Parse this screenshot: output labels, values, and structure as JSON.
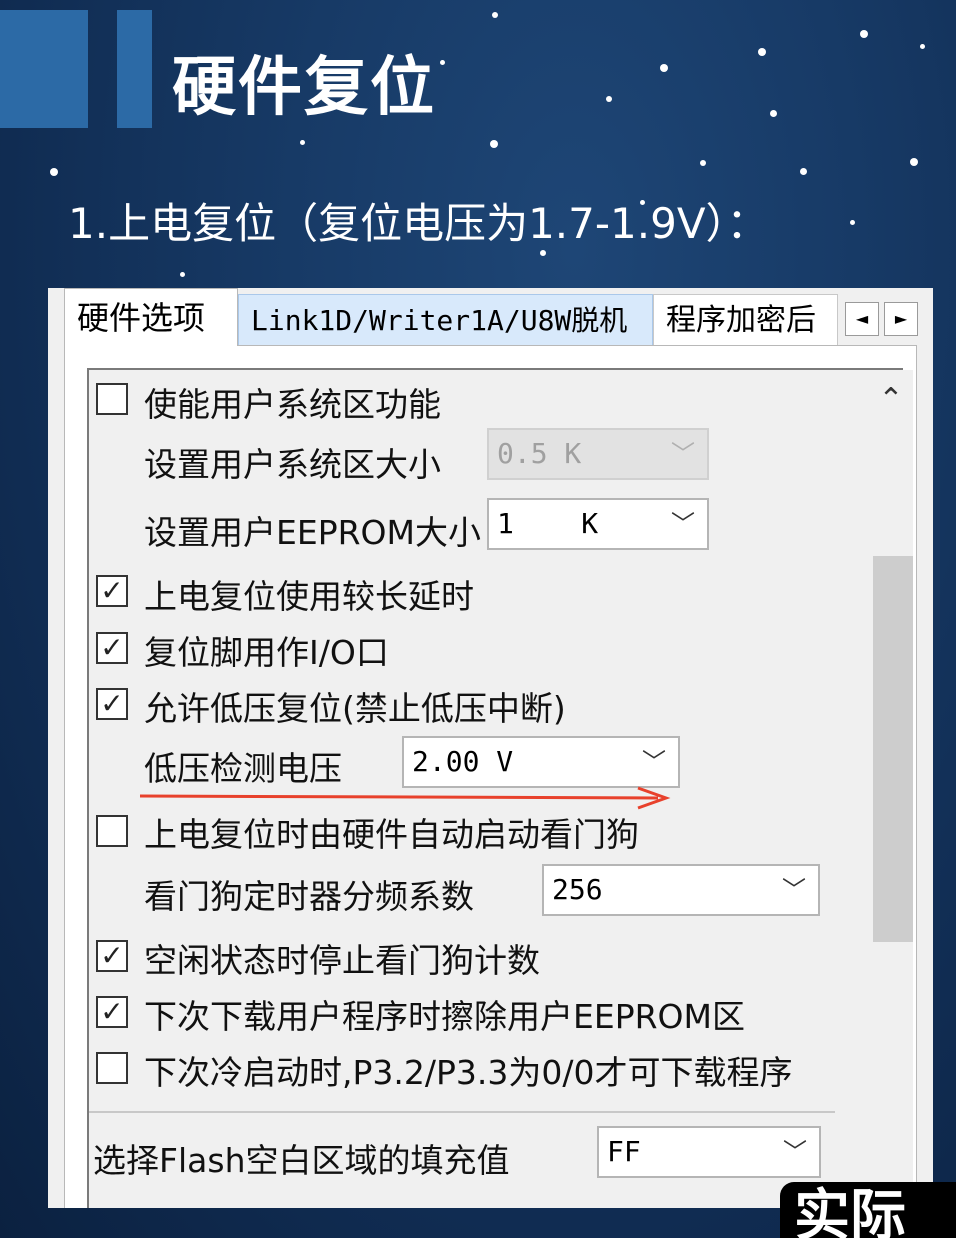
{
  "slide": {
    "title": "硬件复位",
    "subtitle": "1.上电复位（复位电压为1.7-1.9V）："
  },
  "tabs": [
    {
      "label": "硬件选项",
      "active": true
    },
    {
      "label": "Link1D/Writer1A/U8W脱机",
      "active": false
    },
    {
      "label": "程序加密后",
      "active": false
    }
  ],
  "tab_arrows": {
    "left": "◄",
    "right": "►"
  },
  "scrollbar": {
    "up_glyph": "⌃"
  },
  "options": [
    {
      "label": "使能用户系统区功能",
      "checked": false,
      "mark": ""
    },
    {
      "label": "设置用户系统区大小"
    },
    {
      "label": "设置用户EEPROM大小"
    },
    {
      "label": "上电复位使用较长延时",
      "checked": true,
      "mark": "✓"
    },
    {
      "label": "复位脚用作I/O口",
      "checked": true,
      "mark": "✓"
    },
    {
      "label": "允许低压复位(禁止低压中断)",
      "checked": true,
      "mark": "✓"
    },
    {
      "label": "低压检测电压"
    },
    {
      "label": "上电复位时由硬件自动启动看门狗",
      "checked": false,
      "mark": ""
    },
    {
      "label": "看门狗定时器分频系数"
    },
    {
      "label": "空闲状态时停止看门狗计数",
      "checked": true,
      "mark": "✓"
    },
    {
      "label": "下次下载用户程序时擦除用户EEPROM区",
      "checked": true,
      "mark": "✓"
    },
    {
      "label": "下次冷启动时,P3.2/P3.3为0/0才可下载程序",
      "checked": false,
      "mark": ""
    },
    {
      "label": "选择Flash空白区域的填充值"
    }
  ],
  "combos": {
    "user_sys_size": {
      "value": "0.5 K",
      "disabled": true
    },
    "eeprom_size": {
      "value": "1    K",
      "disabled": false
    },
    "lvd_voltage": {
      "value": "2.00 V",
      "disabled": false
    },
    "wdt_prescale": {
      "value": "256",
      "disabled": false
    },
    "flash_fill": {
      "value": "FF",
      "disabled": false
    }
  },
  "chevron": "﹀",
  "caption": "实际",
  "colors": {
    "background": "#173a66",
    "accent_bar": "#2c6aa6",
    "annotation_arrow": "#e8412c",
    "active_tab_bg": "#d8e9fb"
  }
}
